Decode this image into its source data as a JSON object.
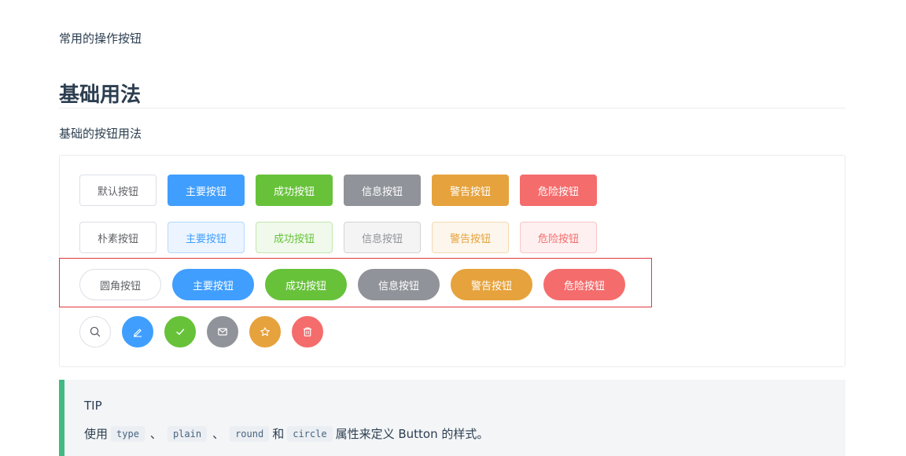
{
  "intro": "常用的操作按钮",
  "section_title": "基础用法",
  "section_desc": "基础的按钮用法",
  "rows": {
    "default": [
      "默认按钮",
      "主要按钮",
      "成功按钮",
      "信息按钮",
      "警告按钮",
      "危险按钮"
    ],
    "plain": [
      "朴素按钮",
      "主要按钮",
      "成功按钮",
      "信息按钮",
      "警告按钮",
      "危险按钮"
    ],
    "round": [
      "圆角按钮",
      "主要按钮",
      "成功按钮",
      "信息按钮",
      "警告按钮",
      "危险按钮"
    ],
    "circle_icons": [
      "search-icon",
      "edit-icon",
      "check-icon",
      "message-icon",
      "star-icon",
      "delete-icon"
    ]
  },
  "colors": {
    "primary": "#409eff",
    "success": "#67c23a",
    "info": "#909399",
    "warning": "#e6a23c",
    "danger": "#f56c6c",
    "tip_border": "#42b983",
    "highlight": "#e0393e"
  },
  "tip": {
    "title": "TIP",
    "prefix": "使用",
    "code1": "type",
    "sep1": "、",
    "code2": "plain",
    "sep2": "、",
    "code3": "round",
    "conj": "和",
    "code4": "circle",
    "suffix": "属性来定义 Button 的样式。"
  }
}
